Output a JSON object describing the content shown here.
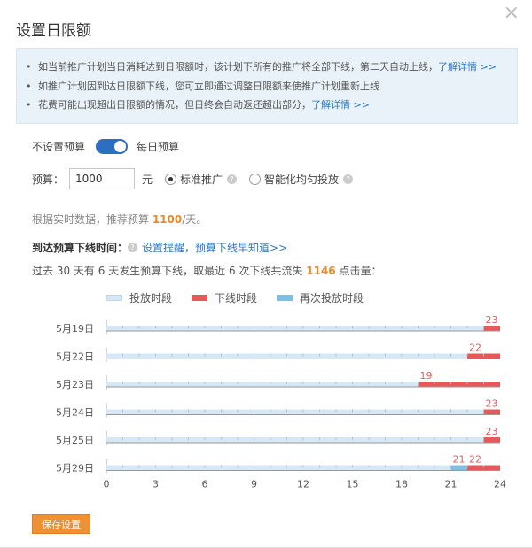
{
  "dialog": {
    "title": "设置日限额",
    "close_glyph": "×"
  },
  "notice": {
    "lines": [
      {
        "text": "如当前推广计划当日消耗达到日限额时，该计划下所有的推广将全部下线，第二天自动上线，",
        "link": "了解详情 >>"
      },
      {
        "text": "如推广计划因到达日限额下线，您可立即通过调整日限额来使推广计划重新上线",
        "link": ""
      },
      {
        "text": "花费可能出现超出日限额的情况，但日终会自动返还超出部分，",
        "link": "了解详情 >>"
      }
    ]
  },
  "budget_toggle": {
    "left_label": "不设置预算",
    "right_label": "每日预算",
    "on": true
  },
  "budget": {
    "label": "预算：",
    "value": "1000",
    "unit": "元",
    "option_standard": "标准推广",
    "option_smart": "智能化均匀投放"
  },
  "suggestion": {
    "prefix": "根据实时数据，推荐预算 ",
    "amount": "1100",
    "suffix": "/天。"
  },
  "offline": {
    "label": "到达预算下线时间：",
    "link": "设置提醒，预算下线早知道>>"
  },
  "stats": {
    "prefix": "过去 30 天有 6 天发生预算下线，取最近 6 次下线共流失 ",
    "amount": "1146",
    "suffix": " 点击量："
  },
  "legend": {
    "active": "投放时段",
    "offline": "下线时段",
    "resumed": "再次投放时段"
  },
  "colors": {
    "active": "#d6e8f5",
    "offline": "#e85858",
    "resumed": "#7fbfe4",
    "link": "#2d78c9",
    "accent": "#f09035"
  },
  "chart_data": {
    "type": "bar",
    "xlim": [
      0,
      24
    ],
    "x_ticks": [
      "0",
      "3",
      "6",
      "9",
      "12",
      "15",
      "18",
      "21",
      "24"
    ],
    "rows": [
      {
        "date": "5月19日",
        "segments": [
          {
            "kind": "active",
            "start": 0,
            "end": 23
          },
          {
            "kind": "offline",
            "start": 23,
            "end": 24
          }
        ],
        "labels": [
          "23"
        ]
      },
      {
        "date": "5月22日",
        "segments": [
          {
            "kind": "active",
            "start": 0,
            "end": 22
          },
          {
            "kind": "offline",
            "start": 22,
            "end": 24
          }
        ],
        "labels": [
          "22"
        ]
      },
      {
        "date": "5月23日",
        "segments": [
          {
            "kind": "active",
            "start": 0,
            "end": 19
          },
          {
            "kind": "offline",
            "start": 19,
            "end": 24
          }
        ],
        "labels": [
          "19"
        ]
      },
      {
        "date": "5月24日",
        "segments": [
          {
            "kind": "active",
            "start": 0,
            "end": 23
          },
          {
            "kind": "offline",
            "start": 23,
            "end": 24
          }
        ],
        "labels": [
          "23"
        ]
      },
      {
        "date": "5月25日",
        "segments": [
          {
            "kind": "active",
            "start": 0,
            "end": 23
          },
          {
            "kind": "offline",
            "start": 23,
            "end": 24
          }
        ],
        "labels": [
          "23"
        ]
      },
      {
        "date": "5月29日",
        "segments": [
          {
            "kind": "active",
            "start": 0,
            "end": 21
          },
          {
            "kind": "resumed",
            "start": 21,
            "end": 22
          },
          {
            "kind": "offline",
            "start": 22,
            "end": 24
          }
        ],
        "labels": [
          "21",
          "22"
        ]
      }
    ]
  },
  "actions": {
    "save_label": "保存设置"
  }
}
